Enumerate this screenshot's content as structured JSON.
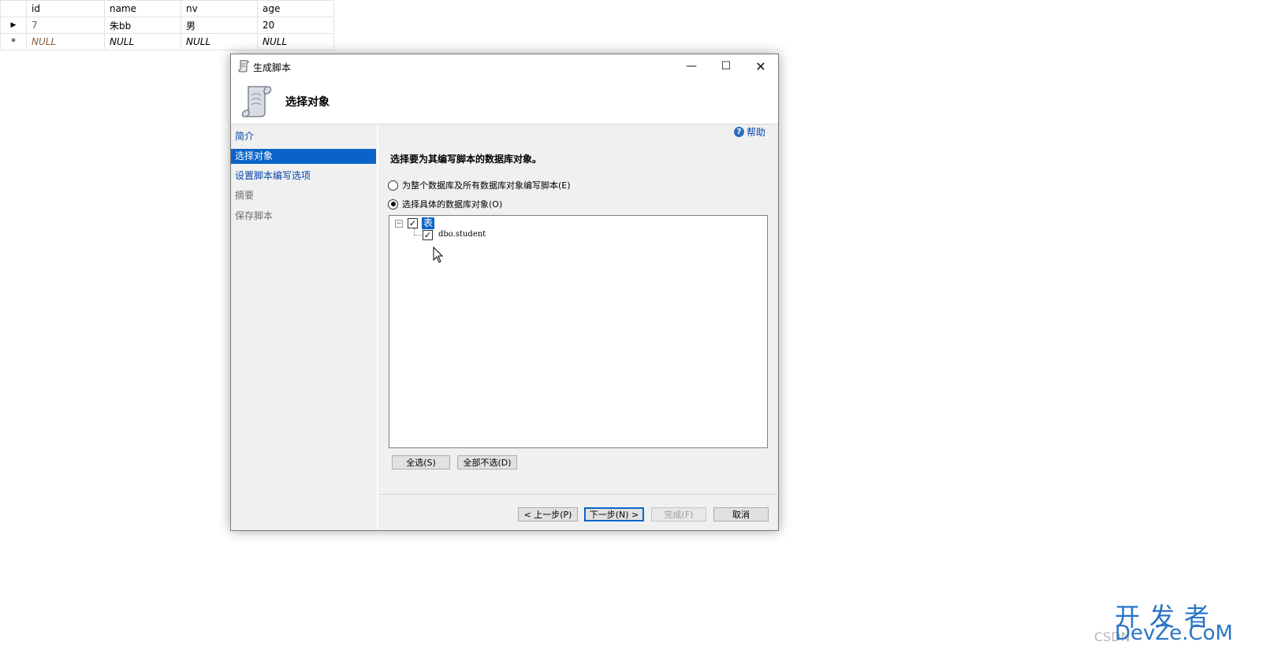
{
  "grid": {
    "columns": [
      "id",
      "name",
      "nv",
      "age"
    ],
    "rows": [
      {
        "marker": "▶",
        "id": "7",
        "name": "朱bb",
        "nv": "男",
        "age": "20"
      },
      {
        "marker": "*",
        "id": "NULL",
        "name": "NULL",
        "nv": "NULL",
        "age": "NULL"
      }
    ]
  },
  "dialog": {
    "title": "生成脚本",
    "window_buttons": {
      "minimize": "—",
      "maximize": "☐",
      "close": "✕"
    },
    "header_title": "选择对象",
    "help": "帮助",
    "nav": [
      {
        "label": "简介",
        "state": "link"
      },
      {
        "label": "选择对象",
        "state": "active"
      },
      {
        "label": "设置脚本编写选项",
        "state": "link"
      },
      {
        "label": "摘要",
        "state": "disabled"
      },
      {
        "label": "保存脚本",
        "state": "disabled"
      }
    ],
    "content_title": "选择要为其编写脚本的数据库对象。",
    "options": [
      {
        "label": "为整个数据库及所有数据库对象编写脚本(E)",
        "selected": false
      },
      {
        "label": "选择具体的数据库对象(O)",
        "selected": true
      }
    ],
    "tree": {
      "root": {
        "label": "表",
        "checked": true,
        "expander": "−"
      },
      "children": [
        {
          "label": "dbo.student",
          "checked": true
        }
      ]
    },
    "select_all": "全选(S)",
    "deselect_all": "全部不选(D)",
    "footer": {
      "prev": "< 上一步(P)",
      "next": "下一步(N) >",
      "finish": "完成(F)",
      "cancel": "取消"
    }
  },
  "watermark": {
    "cn": "开发者",
    "en": "DevZe.CoM",
    "csdn": "CSDN"
  },
  "colors": {
    "accent": "#0a64c8",
    "link": "#0645ad",
    "watermark": "#2a74c8"
  }
}
